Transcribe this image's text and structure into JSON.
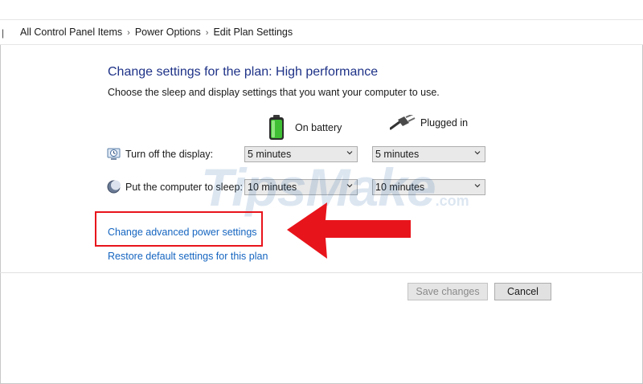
{
  "breadcrumb": {
    "items": [
      "All Control Panel Items",
      "Power Options",
      "Edit Plan Settings"
    ]
  },
  "header": {
    "title": "Change settings for the plan: High performance",
    "subtitle": "Choose the sleep and display settings that you want your computer to use."
  },
  "columns": {
    "battery": "On battery",
    "plugged": "Plugged in"
  },
  "settings": [
    {
      "label": "Turn off the display:",
      "battery": "5 minutes",
      "plugged": "5 minutes"
    },
    {
      "label": "Put the computer to sleep:",
      "battery": "10 minutes",
      "plugged": "10 minutes"
    }
  ],
  "links": {
    "advanced": "Change advanced power settings",
    "restore": "Restore default settings for this plan"
  },
  "buttons": {
    "save": "Save changes",
    "cancel": "Cancel"
  },
  "watermark": {
    "main": "TipsMake",
    "suffix": ".com"
  },
  "colors": {
    "title": "#1e3287",
    "link": "#1565c0",
    "annotation": "#e8141b"
  },
  "icons": {
    "battery": "battery-icon",
    "plug": "plug-icon",
    "display": "display-timer-icon",
    "sleep": "sleep-moon-icon"
  }
}
